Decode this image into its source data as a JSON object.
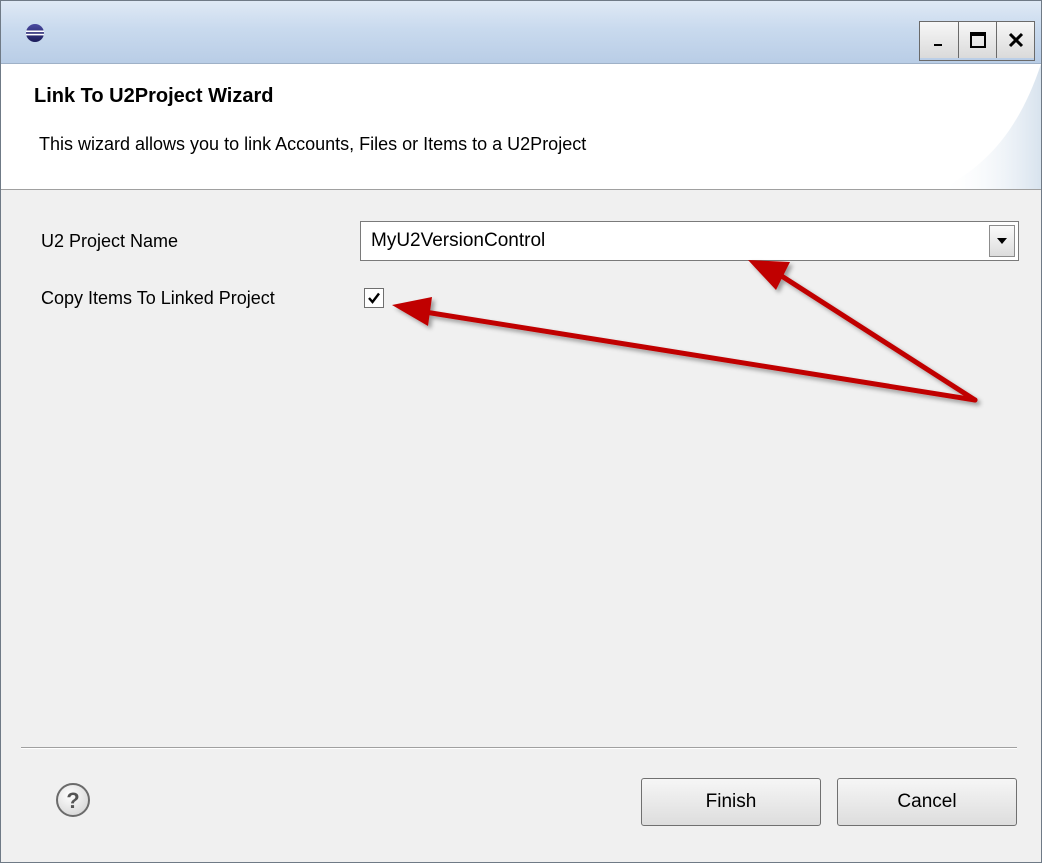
{
  "window": {
    "title": "",
    "icon": "eclipse-icon",
    "controls": [
      "minimize-icon",
      "maximize-icon",
      "close-icon"
    ]
  },
  "wizard": {
    "title": "Link To U2Project Wizard",
    "description": "This wizard allows you to link Accounts, Files or Items to a U2Project"
  },
  "form": {
    "project_name_label": "U2 Project Name",
    "project_name_value": "MyU2VersionControl",
    "copy_items_label": "Copy Items To Linked Project",
    "copy_items_checked": true
  },
  "footer": {
    "help_icon": "help-icon",
    "finish_label": "Finish",
    "cancel_label": "Cancel"
  },
  "annotations": {
    "arrow_color": "#c00000"
  }
}
